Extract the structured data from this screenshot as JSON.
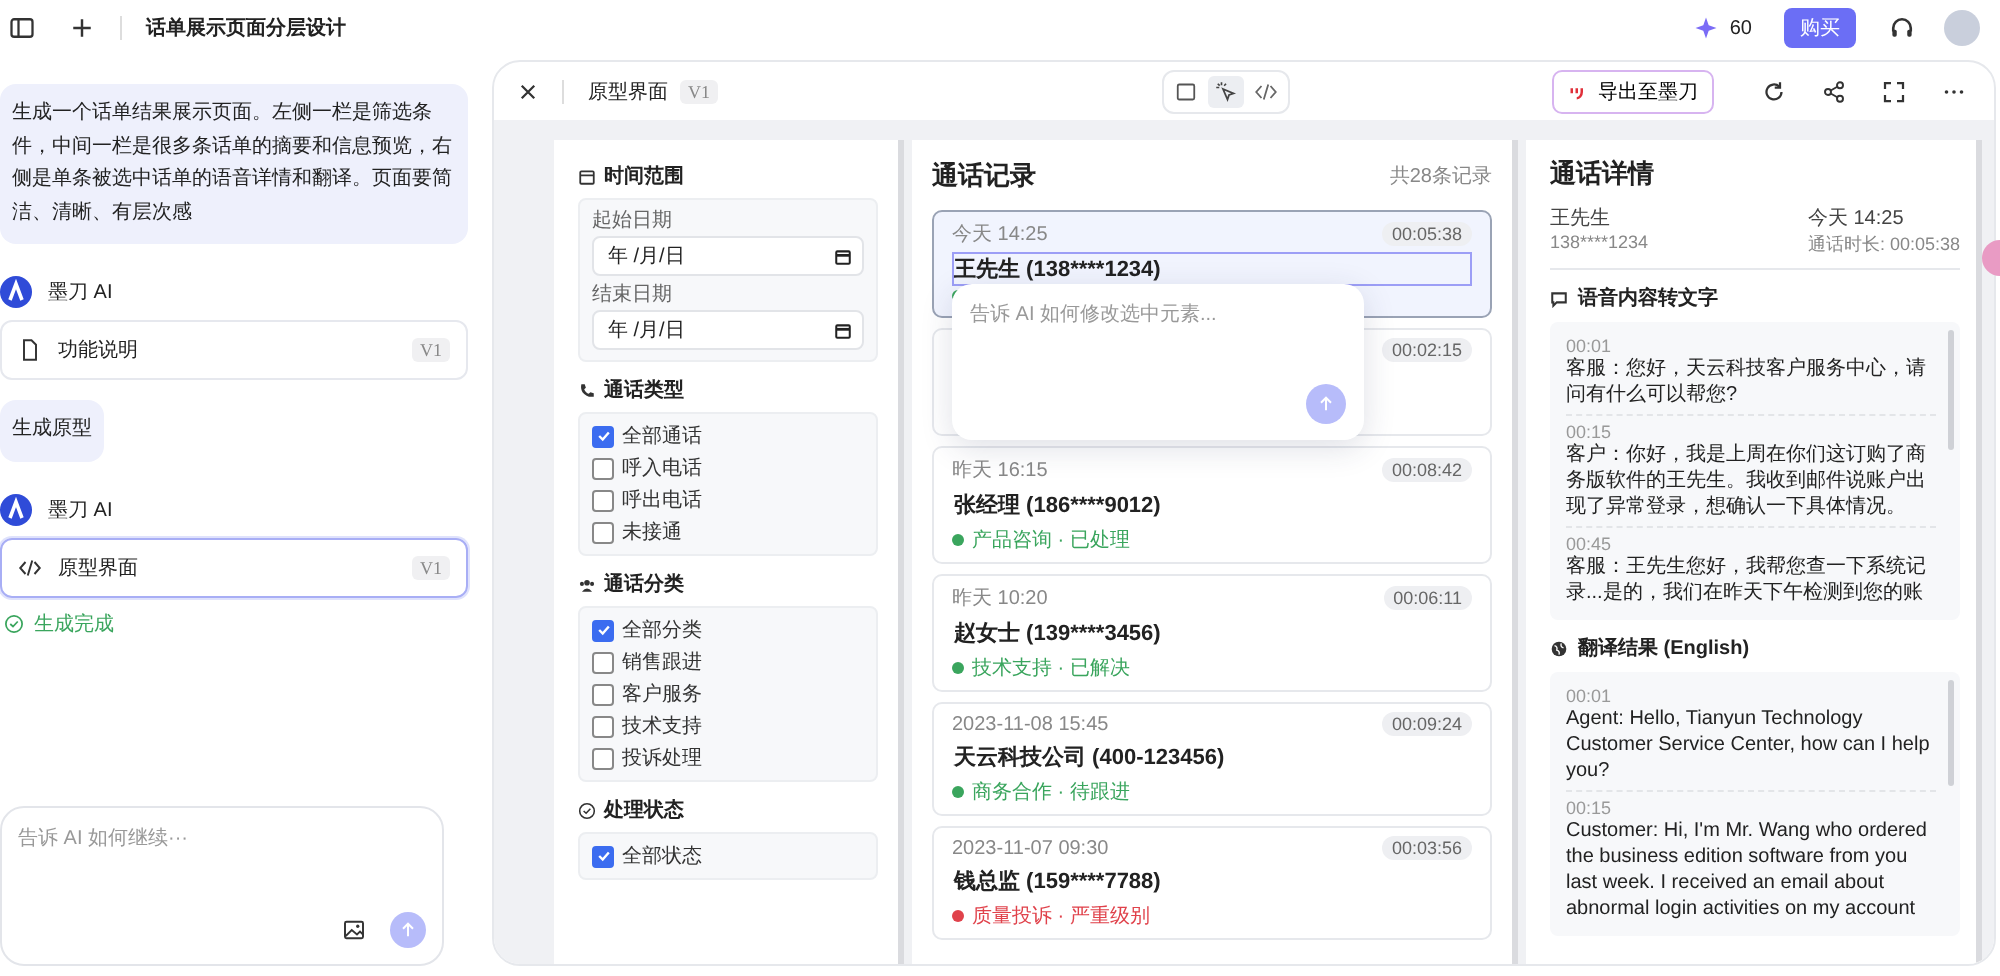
{
  "topbar": {
    "title": "话单展示页面分层设计",
    "credits": "60",
    "buy_button": "购买"
  },
  "chat": {
    "messages": [
      {
        "kind": "user",
        "text": "生成一个话单结果展示页面。左侧一栏是筛选条件，中间一栏是很多条话单的摘要和信息预览，右侧是单条被选中话单的语音详情和翻译。页面要简洁、清晰、有层次感"
      },
      {
        "kind": "ai",
        "sender": "墨刀 AI",
        "card": {
          "kind": "doc",
          "label": "功能说明",
          "version": "V1",
          "selected": false
        }
      },
      {
        "kind": "user",
        "text": "生成原型"
      },
      {
        "kind": "ai",
        "sender": "墨刀 AI",
        "card": {
          "kind": "code",
          "label": "原型界面",
          "version": "V1",
          "selected": true
        },
        "status": "生成完成"
      }
    ],
    "input": {
      "placeholder": "告诉 AI 如何继续···"
    }
  },
  "preview": {
    "title": "原型界面",
    "version": "V1",
    "view_modes": [
      {
        "kind": "frame",
        "selected": false
      },
      {
        "kind": "pointer",
        "selected": true
      },
      {
        "kind": "code",
        "selected": false
      }
    ],
    "export_button": "导出至墨刀"
  },
  "filters": [
    {
      "kind": "dates",
      "title": "时间范围",
      "fields": [
        {
          "label": "起始日期",
          "placeholder": "年 /月/日"
        },
        {
          "label": "结束日期",
          "placeholder": "年 /月/日"
        }
      ]
    },
    {
      "kind": "checks",
      "title": "通话类型",
      "options": [
        {
          "label": "全部通话",
          "checked": true
        },
        {
          "label": "呼入电话",
          "checked": false
        },
        {
          "label": "呼出电话",
          "checked": false
        },
        {
          "label": "未接通",
          "checked": false
        }
      ]
    },
    {
      "kind": "checks",
      "title": "通话分类",
      "options": [
        {
          "label": "全部分类",
          "checked": true
        },
        {
          "label": "销售跟进",
          "checked": false
        },
        {
          "label": "客户服务",
          "checked": false
        },
        {
          "label": "技术支持",
          "checked": false
        },
        {
          "label": "投诉处理",
          "checked": false
        }
      ]
    },
    {
      "kind": "checks",
      "title": "处理状态",
      "options": [
        {
          "label": "全部状态",
          "checked": true
        }
      ]
    }
  ],
  "records": {
    "title": "通话记录",
    "count": "共28条记录",
    "items": [
      {
        "time": "今天 14:25",
        "duration": "00:05:38",
        "name": "王先生 (138****1234)",
        "status": {
          "color": "#3aa55d"
        },
        "selected": true,
        "outlined": true
      },
      {
        "duration": "00:02:15",
        "selected": false
      },
      {
        "time": "昨天 16:15",
        "duration": "00:08:42",
        "name": "张经理 (186****9012)",
        "status": {
          "text": "产品咨询 · 已处理",
          "color": "#3aa55d"
        },
        "selected": false,
        "outlined": false
      },
      {
        "time": "昨天 10:20",
        "duration": "00:06:11",
        "name": "赵女士 (139****3456)",
        "status": {
          "text": "技术支持 · 已解决",
          "color": "#3aa55d"
        },
        "selected": false,
        "outlined": false
      },
      {
        "time": "2023-11-08 15:45",
        "duration": "00:09:24",
        "name": "天云科技公司 (400-123456)",
        "status": {
          "text": "商务合作 · 待跟进",
          "color": "#3aa55d"
        },
        "selected": false,
        "outlined": false
      },
      {
        "time": "2023-11-07 09:30",
        "duration": "00:03:56",
        "name": "钱总监 (159****7788)",
        "status": {
          "text": "质量投诉 · 严重级别",
          "color": "#e0424b"
        },
        "selected": false,
        "outlined": false
      }
    ]
  },
  "popup": {
    "placeholder": "告诉 AI 如何修改选中元素..."
  },
  "detail": {
    "title": "通话详情",
    "name": "王先生",
    "phone": "138****1234",
    "time": "今天 14:25",
    "duration": "通话时长: 00:05:38",
    "sections": [
      {
        "kind": "transcript",
        "title": "语音内容转文字",
        "entries": [
          {
            "time": "00:01",
            "text": "客服：您好，天云科技客户服务中心，请问有什么可以帮您?"
          },
          {
            "time": "00:15",
            "text": "客户：你好，我是上周在你们这订购了商务版软件的王先生。我收到邮件说账户出现了异常登录，想确认一下具体情况。"
          },
          {
            "time": "00:45",
            "text": "客服：王先生您好，我帮您查一下系统记录...是的，我们在昨天下午检测到您的账"
          }
        ]
      },
      {
        "kind": "translation",
        "title": "翻译结果 (English)",
        "entries": [
          {
            "time": "00:01",
            "text": "Agent: Hello, Tianyun Technology Customer Service Center, how can I help you?"
          },
          {
            "time": "00:15",
            "text": "Customer: Hi, I'm Mr. Wang who ordered the business edition software from you last week. I received an email about abnormal login activities on my account"
          }
        ]
      }
    ]
  }
}
